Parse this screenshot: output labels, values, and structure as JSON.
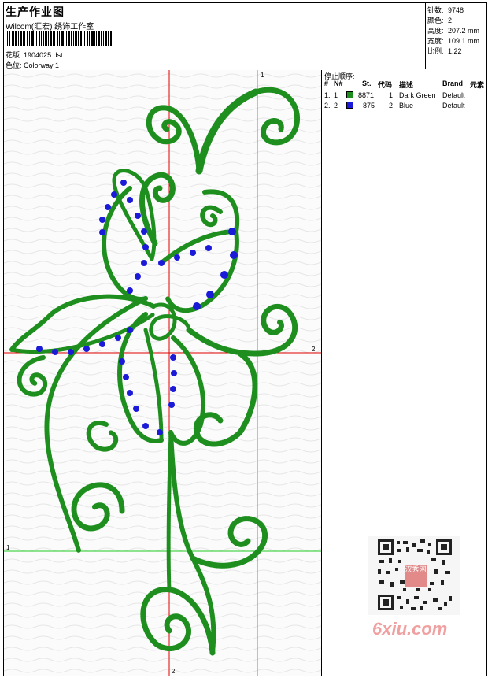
{
  "header": {
    "title": "生产作业图",
    "studio": "Wilcom(汇宏) 绣饰工作室",
    "design_label": "花版:",
    "design_value": "1904025.dst",
    "colorway_label": "色位:",
    "colorway_value": "Colorway 1"
  },
  "stats": {
    "stitches_label": "针数:",
    "stitches_value": "9748",
    "colors_label": "颜色:",
    "colors_value": "2",
    "height_label": "高度:",
    "height_value": "207.2 mm",
    "width_label": "宽度:",
    "width_value": "109.1 mm",
    "scale_label": "比例:",
    "scale_value": "1.22"
  },
  "stop_sequence": {
    "title": "停止顺序:",
    "columns": [
      "#",
      "N#",
      "St.",
      "代码",
      "描述",
      "Brand",
      "元素"
    ],
    "rows": [
      {
        "index": "1.",
        "needle": "1",
        "swatch": "#1e8f1e",
        "stitches": "8871",
        "code": "1",
        "description": "Dark Green",
        "brand": "Default"
      },
      {
        "index": "2.",
        "needle": "2",
        "swatch": "#1a1ad8",
        "stitches": "875",
        "code": "2",
        "description": "Blue",
        "brand": "Default"
      }
    ]
  },
  "guides": {
    "top_mark": "1",
    "right_mark": "2",
    "left_mark": "1",
    "bottom_mark": "2"
  },
  "colors": {
    "thread_green": "#1e8f1e",
    "thread_blue": "#1a1ad8",
    "guide_red": "#e00000",
    "guide_green": "#22cc22"
  },
  "watermark": {
    "site": "6xiu.com",
    "logo_text": "汉秀网"
  }
}
